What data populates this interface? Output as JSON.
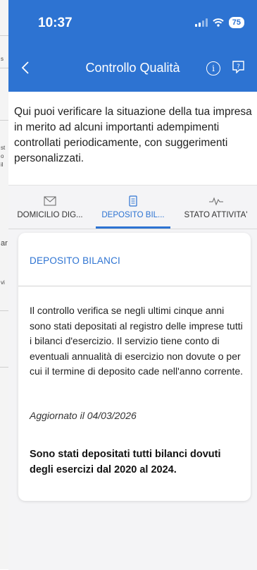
{
  "status_bar": {
    "time": "10:37",
    "battery": "75"
  },
  "header": {
    "title": "Controllo Qualità"
  },
  "intro_text": "Qui puoi verificare la situazione della tua impresa in merito ad alcuni importanti adempimenti controllati periodicamente, con suggerimenti personalizzati.",
  "tabs": [
    {
      "label": "DOMICILIO DIG...",
      "icon": "envelope-icon",
      "active": false
    },
    {
      "label": "DEPOSITO BIL...",
      "icon": "document-icon",
      "active": true
    },
    {
      "label": "STATO ATTIVITA'",
      "icon": "pulse-icon",
      "active": false
    }
  ],
  "card": {
    "title": "DEPOSITO BILANCI",
    "description": "Il controllo verifica se negli ultimi cinque anni sono stati depositati al registro delle imprese tutti i bilanci d'esercizio. Il servizio tiene conto di eventuali annualità di esercizio non dovute o per cui il termine di deposito cade nell'anno corrente.",
    "updated": "Aggiornato il 04/03/2026",
    "result": "Sono stati depositati tutti bilanci dovuti degli esercizi dal 2020 al 2024."
  },
  "colors": {
    "brand_blue": "#2d73d2",
    "tabs_background": "#f4f4f6"
  },
  "background_fragments": [
    "s",
    "st",
    "o",
    "il",
    "ar",
    "vi"
  ]
}
